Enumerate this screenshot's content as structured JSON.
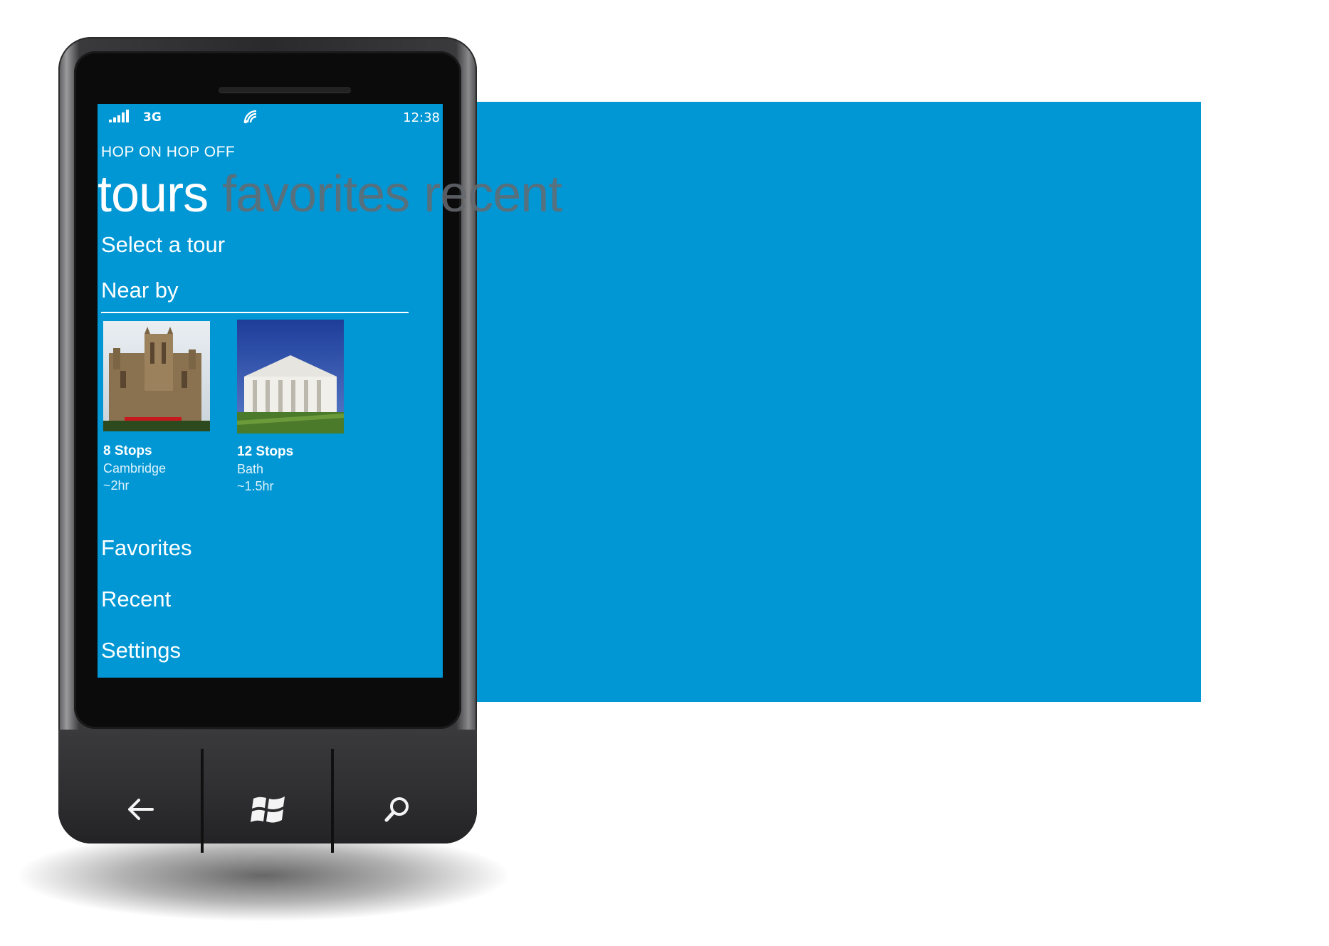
{
  "status_bar": {
    "network": "3G",
    "time": "12:38"
  },
  "app": {
    "title": "HOP ON HOP OFF"
  },
  "pivot": {
    "active": "tours",
    "others": [
      "favorites",
      "recent"
    ]
  },
  "tours_page": {
    "heading": "Select a tour",
    "near_by_label": "Near by",
    "tiles": [
      {
        "stops": "8 Stops",
        "city": "Cambridge",
        "duration": "~2hr",
        "image": "cathedral-photo"
      },
      {
        "stops": "12 Stops",
        "city": "Bath",
        "duration": "~1.5hr",
        "image": "senate-house-photo"
      }
    ],
    "links": [
      "Favorites",
      "Recent",
      "Settings"
    ]
  },
  "hardware_buttons": [
    "back-icon",
    "windows-start-icon",
    "search-icon"
  ],
  "colors": {
    "accent": "#0097d4",
    "inactive_pivot": "#666a70"
  }
}
